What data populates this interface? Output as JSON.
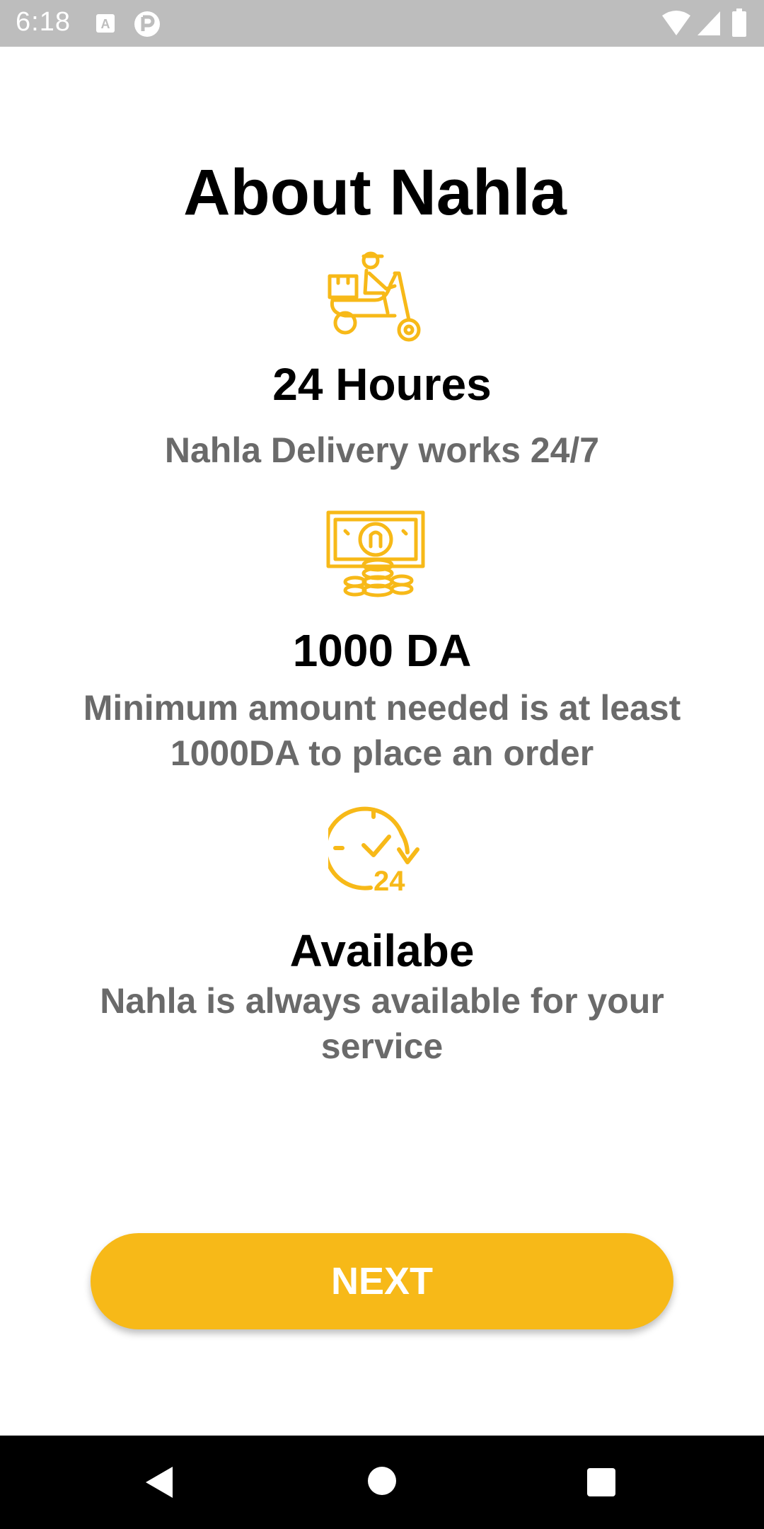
{
  "status_bar": {
    "time": "6:18",
    "icons": [
      "text-app-icon",
      "privacy-app-icon",
      "wifi-icon",
      "signal-icon",
      "battery-icon"
    ]
  },
  "title": "About Nahla",
  "features": [
    {
      "icon": "delivery-scooter-icon",
      "heading": "24 Houres",
      "description": "Nahla Delivery works 24/7"
    },
    {
      "icon": "money-coins-icon",
      "heading": "1000 DA",
      "description": "Minimum amount needed is at least 1000DA to place an order"
    },
    {
      "icon": "clock-24-icon",
      "clock_text": "24",
      "heading": "Availabe",
      "description": "Nahla is always available for your service"
    }
  ],
  "next_button": {
    "label": "NEXT"
  },
  "navigation": {
    "buttons": [
      "back-icon",
      "home-icon",
      "recents-icon"
    ]
  },
  "colors": {
    "accent": "#f7b918",
    "status_bar": "#bdbdbd",
    "heading": "#000000",
    "description": "#6a6a6a"
  }
}
